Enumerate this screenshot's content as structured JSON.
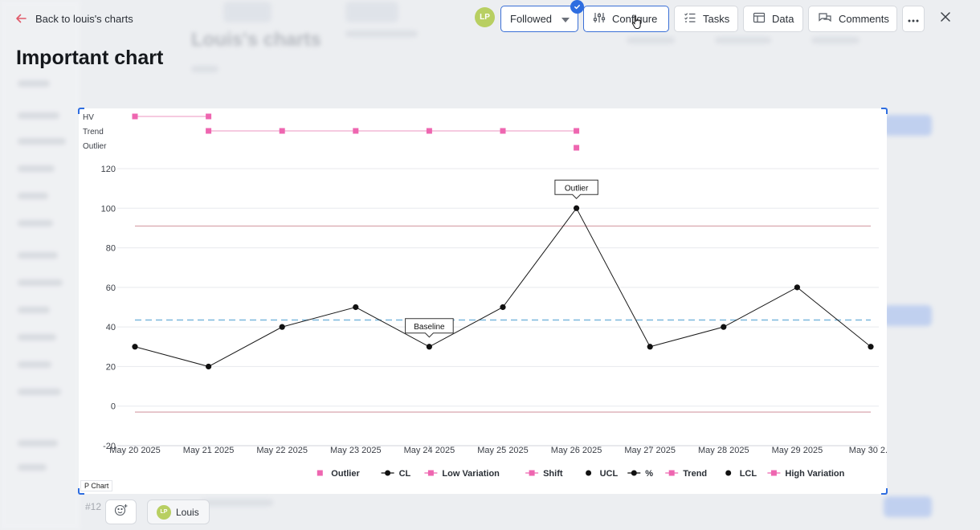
{
  "header": {
    "back_label": "Back to louis's charts",
    "page_title": "Important chart",
    "avatar_initials": "LP",
    "followed_label": "Followed",
    "configure_label": "Configure",
    "tasks_label": "Tasks",
    "data_label": "Data",
    "comments_label": "Comments"
  },
  "background": {
    "title": "Louis's charts"
  },
  "footer": {
    "issue_number": "#12",
    "user_initials": "LP",
    "user_name": "Louis"
  },
  "colors": {
    "accent": "#2e6de0",
    "pink": "#ee66b0",
    "pink_line": "#f4b8d6",
    "center_line": "#7ab8dd",
    "limit_line": "#d9a5ad",
    "data_line": "#1a1a1a"
  },
  "chart_data": {
    "type": "line",
    "chart_label": "P Chart",
    "categories": [
      "May 20 2025",
      "May 21 2025",
      "May 22 2025",
      "May 23 2025",
      "May 24 2025",
      "May 25 2025",
      "May 26 2025",
      "May 27 2025",
      "May 28 2025",
      "May 29 2025",
      "May 30 2..."
    ],
    "series": [
      {
        "name": "%",
        "values": [
          30,
          20,
          40,
          50,
          30,
          50,
          100,
          30,
          40,
          60,
          30
        ]
      }
    ],
    "cl": 43.5,
    "ucl": 91,
    "lcl": -3,
    "ylim": [
      -20,
      120
    ],
    "yticks": [
      -20,
      0,
      20,
      40,
      60,
      80,
      100,
      120
    ],
    "grid": true,
    "annotations": [
      {
        "label": "Baseline",
        "index": 4
      },
      {
        "label": "Outlier",
        "index": 6
      }
    ],
    "rule_rows": [
      {
        "label": "HV",
        "segments": [
          [
            0,
            1
          ]
        ],
        "points": []
      },
      {
        "label": "Trend",
        "segments": [
          [
            1,
            6
          ]
        ],
        "points": []
      },
      {
        "label": "Outlier",
        "segments": [],
        "points": [
          6
        ]
      }
    ],
    "legend": [
      {
        "name": "Outlier",
        "marker": "square"
      },
      {
        "name": "CL",
        "marker": "dot-line"
      },
      {
        "name": "Low Variation",
        "marker": "square-line"
      },
      {
        "name": "Shift",
        "marker": "square-line"
      },
      {
        "name": "UCL",
        "marker": "dot"
      },
      {
        "name": "%",
        "marker": "dot-line"
      },
      {
        "name": "Trend",
        "marker": "square-line"
      },
      {
        "name": "LCL",
        "marker": "dot"
      },
      {
        "name": "High Variation",
        "marker": "square-line"
      }
    ],
    "legend_position": "bottom"
  }
}
